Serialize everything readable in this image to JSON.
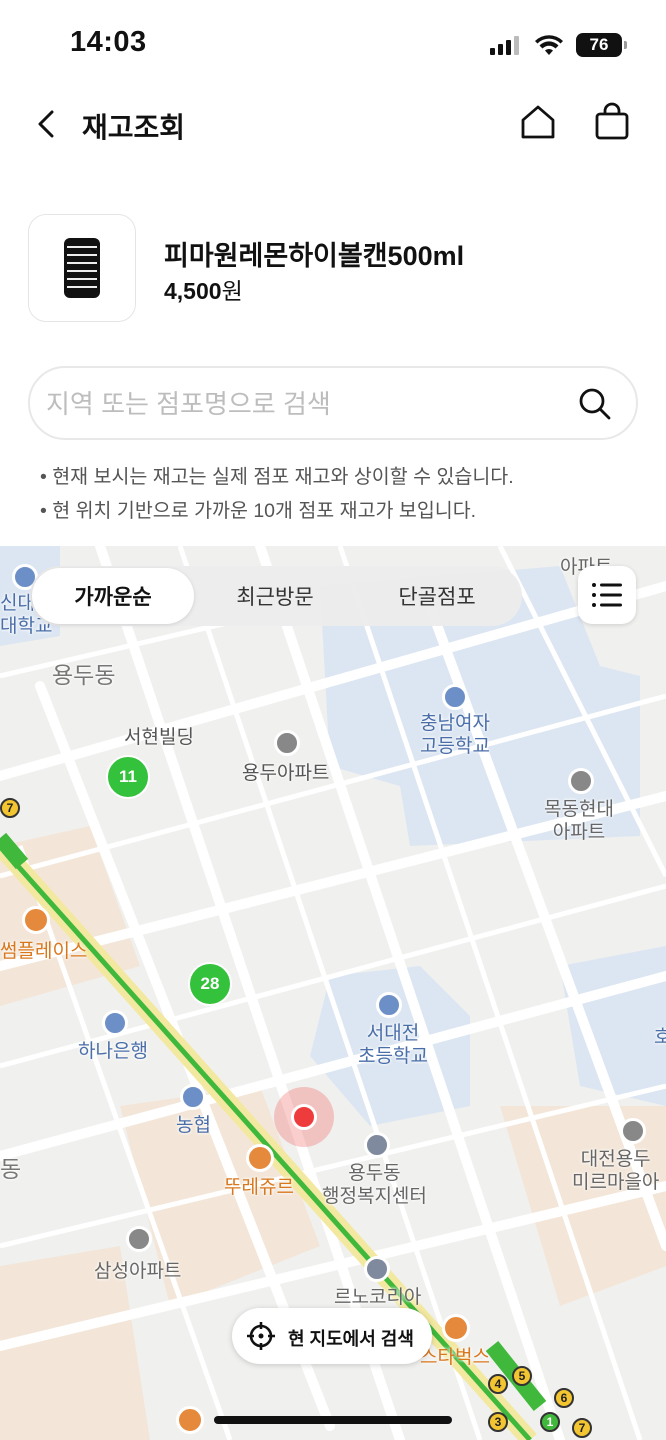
{
  "status_bar": {
    "time": "14:03",
    "battery": "76"
  },
  "header": {
    "title": "재고조회"
  },
  "product": {
    "name": "피마원레몬하이볼캔500ml",
    "price": "4,500",
    "currency": "원"
  },
  "search": {
    "placeholder": "지역 또는 점포명으로 검색"
  },
  "notes": [
    "• 현재 보시는 재고는 실제 점포 재고와 상이할 수 있습니다.",
    "• 현 위치 기반으로 가까운 10개 점포 재고가 보입니다."
  ],
  "tabs": [
    {
      "label": "가까운순",
      "active": true
    },
    {
      "label": "최근방문",
      "active": false
    },
    {
      "label": "단골점포",
      "active": false
    }
  ],
  "map": {
    "labels": {
      "yongdu_dong": "용두동",
      "seohyeon_building": "서현빌딩",
      "yongdu_apt": "용두아파트",
      "chungnam_girls": "충남여자\n고등학교",
      "mokdong_hyundai": "목동현대\n아파트",
      "sum_place": "썸플레이스",
      "hana_bank": "하나은행",
      "nonghyup": "농협",
      "seodaejeon_elem": "서대전\n초등학교",
      "tous_les_jours": "뚜레쥬르",
      "yongdu_admin": "용두동\n행정복지센터",
      "daejeon_yongdu": "대전용두\n미르마을아",
      "samsung_apt": "삼성아파트",
      "renault_korea": "르노코리아",
      "starbucks": "스타벅스",
      "sinhan_univ": "신대\n대학교",
      "dong_left": "동",
      "top_apt": "아파트",
      "ho_right": "호"
    },
    "bus_stops": [
      "11",
      "28"
    ],
    "subway_exits": [
      "7",
      "5",
      "6",
      "4",
      "3",
      "1",
      "7"
    ],
    "search_here_label": "현 지도에서 검색"
  },
  "colors": {
    "accent_green": "#34c13b",
    "location_red": "#ee3b3b",
    "school_blue": "#4a6ea8",
    "cafe_orange": "#d9771d"
  }
}
